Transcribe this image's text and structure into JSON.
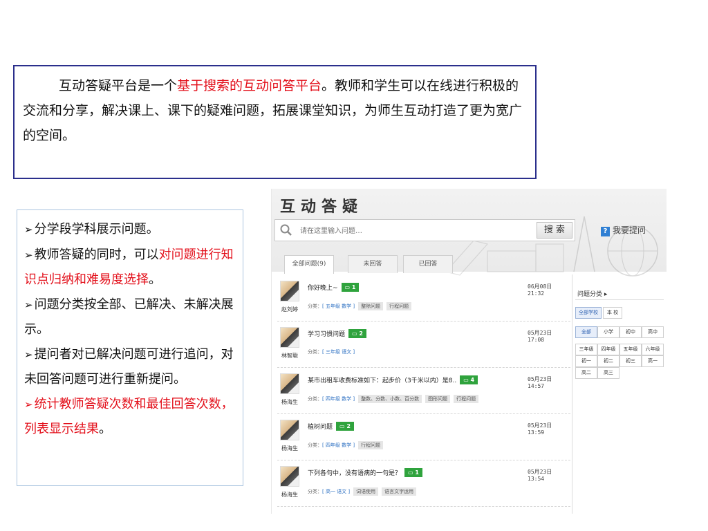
{
  "intro": {
    "p1": "互动答疑平台是一个",
    "p_highlight": "基于搜索的互动问答平台",
    "p2": "。教师和学生可以在线进行积极的交流和分享，解决课上、课下的疑难问题，拓展课堂知识，为师生互动打造了更为宽广的空间。"
  },
  "features": {
    "f1": "分学段学科展示问题。",
    "f2a": "教师答疑的同时，可以",
    "f2b": "对问题进行知识点归纳和难易度选择",
    "f2c": "。",
    "f3": "问题分类按全部、已解决、未解决展示。",
    "f4": "提问者对已解决问题可进行追问，对未回答问题可进行重新提问。",
    "f5a": "统计教师答疑次数和最佳回答次数，列表显示结果",
    "f5b": "。"
  },
  "app": {
    "title": "互动答疑",
    "search_placeholder": "请在这里输入问题…",
    "search_button": "搜 索",
    "ask_icon": "?",
    "ask_label": "我要提问",
    "tabs": [
      "全部问题(9)",
      "未回答",
      "已回答"
    ]
  },
  "questions": [
    {
      "user": "赵刘婷",
      "title": "你好晚上~",
      "answers": "1",
      "time": "06月08日 21:32",
      "cat_prefix": "分类：",
      "subject": "[ 五年级 数学 ]",
      "tags": [
        "整除问题",
        "行程问题"
      ]
    },
    {
      "user": "林智聪",
      "title": "学习习惯问题",
      "answers": "2",
      "time": "05月23日 17:08",
      "cat_prefix": "分类：",
      "subject": "[ 三年级 语文 ]",
      "tags": []
    },
    {
      "user": "杨海生",
      "title": "某市出租车收费标准如下：起步价（3千米以内）是8..",
      "answers": "4",
      "time": "05月23日 14:57",
      "cat_prefix": "分类：",
      "subject": "[ 四年级 数学 ]",
      "tags": [
        "整数、分数、小数、百分数",
        "图形问题",
        "行程问题"
      ]
    },
    {
      "user": "杨海生",
      "title": "植树问题",
      "answers": "2",
      "time": "05月23日 13:59",
      "cat_prefix": "分类：",
      "subject": "[ 四年级 数学 ]",
      "tags": [
        "行程问题"
      ]
    },
    {
      "user": "杨海生",
      "title": "下列各句中，没有语病的一句是？",
      "answers": "1",
      "time": "05月23日 13:54",
      "cat_prefix": "分类：",
      "subject": "[ 高一 语文 ]",
      "tags": [
        "词语使用",
        "语言文字运用"
      ]
    }
  ],
  "categories": {
    "title": "问题分类 ▸",
    "scope": [
      "全部学校",
      "本 校"
    ],
    "levels": [
      "全部",
      "小学",
      "初中",
      "高中"
    ],
    "grades": [
      "三年级",
      "四年级",
      "五年级",
      "六年级",
      "初一",
      "初二",
      "初三",
      "高一",
      "高二",
      "高三"
    ]
  }
}
